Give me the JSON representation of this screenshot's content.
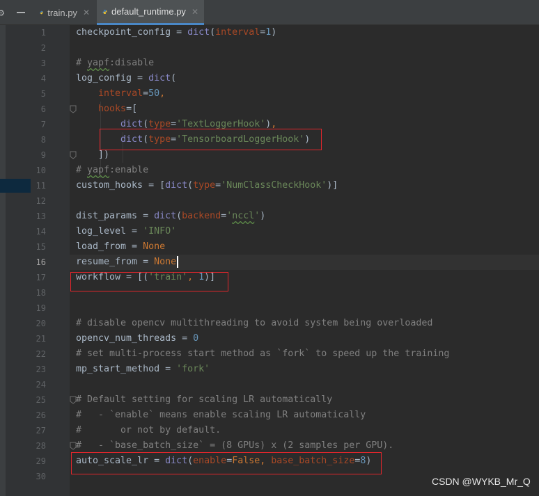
{
  "tabs": [
    {
      "label": "train.py",
      "active": false
    },
    {
      "label": "default_runtime.py",
      "active": true
    }
  ],
  "current_line": 16,
  "lines": [
    {
      "num": "1",
      "tokens": [
        {
          "t": "checkpoint_config = "
        },
        {
          "t": "dict",
          "c": "fn"
        },
        {
          "t": "("
        },
        {
          "t": "interval",
          "c": "kwarg"
        },
        {
          "t": "="
        },
        {
          "t": "1",
          "c": "nm"
        },
        {
          "t": ")"
        }
      ]
    },
    {
      "num": "2",
      "tokens": []
    },
    {
      "num": "3",
      "tokens": [
        {
          "t": "# ",
          "c": "cm"
        },
        {
          "t": "yapf",
          "c": "cm sq"
        },
        {
          "t": ":disable",
          "c": "cm"
        }
      ]
    },
    {
      "num": "4",
      "tokens": [
        {
          "t": "log_config = "
        },
        {
          "t": "dict",
          "c": "fn"
        },
        {
          "t": "("
        }
      ]
    },
    {
      "num": "5",
      "tokens": [
        {
          "t": "    "
        },
        {
          "t": "interval",
          "c": "kwarg"
        },
        {
          "t": "="
        },
        {
          "t": "50",
          "c": "nm"
        },
        {
          "t": ",",
          "c": "kw"
        }
      ]
    },
    {
      "num": "6",
      "tokens": [
        {
          "t": "    "
        },
        {
          "t": "hooks",
          "c": "kwarg"
        },
        {
          "t": "=["
        }
      ]
    },
    {
      "num": "7",
      "tokens": [
        {
          "t": "        "
        },
        {
          "t": "dict",
          "c": "fn"
        },
        {
          "t": "("
        },
        {
          "t": "type",
          "c": "kwarg"
        },
        {
          "t": "="
        },
        {
          "t": "'TextLoggerHook'",
          "c": "st"
        },
        {
          "t": ")"
        },
        {
          "t": ",",
          "c": "kw"
        }
      ]
    },
    {
      "num": "8",
      "tokens": [
        {
          "t": "        "
        },
        {
          "t": "dict",
          "c": "fn"
        },
        {
          "t": "("
        },
        {
          "t": "type",
          "c": "kwarg"
        },
        {
          "t": "="
        },
        {
          "t": "'TensorboardLoggerHook'",
          "c": "st"
        },
        {
          "t": ")"
        }
      ]
    },
    {
      "num": "9",
      "tokens": [
        {
          "t": "    ])"
        }
      ]
    },
    {
      "num": "10",
      "tokens": [
        {
          "t": "# ",
          "c": "cm"
        },
        {
          "t": "yapf",
          "c": "cm sq"
        },
        {
          "t": ":enable",
          "c": "cm"
        }
      ]
    },
    {
      "num": "11",
      "tokens": [
        {
          "t": "custom_hooks = ["
        },
        {
          "t": "dict",
          "c": "fn"
        },
        {
          "t": "("
        },
        {
          "t": "type",
          "c": "kwarg"
        },
        {
          "t": "="
        },
        {
          "t": "'NumClassCheckHook'",
          "c": "st"
        },
        {
          "t": ")]"
        }
      ]
    },
    {
      "num": "12",
      "tokens": []
    },
    {
      "num": "13",
      "tokens": [
        {
          "t": "dist_params = "
        },
        {
          "t": "dict",
          "c": "fn"
        },
        {
          "t": "("
        },
        {
          "t": "backend",
          "c": "kwarg"
        },
        {
          "t": "="
        },
        {
          "t": "'",
          "c": "st"
        },
        {
          "t": "nccl",
          "c": "st sq"
        },
        {
          "t": "'",
          "c": "st"
        },
        {
          "t": ")"
        }
      ]
    },
    {
      "num": "14",
      "tokens": [
        {
          "t": "log_level = "
        },
        {
          "t": "'INFO'",
          "c": "st"
        }
      ]
    },
    {
      "num": "15",
      "tokens": [
        {
          "t": "load_from = "
        },
        {
          "t": "None",
          "c": "kw"
        }
      ]
    },
    {
      "num": "16",
      "tokens": [
        {
          "t": "resume_from = "
        },
        {
          "t": "None",
          "c": "kw"
        }
      ],
      "caret": true
    },
    {
      "num": "17",
      "tokens": [
        {
          "t": "workflow = [("
        },
        {
          "t": "'train'",
          "c": "st"
        },
        {
          "t": ", ",
          "c": "kw"
        },
        {
          "t": "1",
          "c": "nm"
        },
        {
          "t": ")]"
        }
      ]
    },
    {
      "num": "18",
      "tokens": []
    },
    {
      "num": "19",
      "tokens": []
    },
    {
      "num": "20",
      "tokens": [
        {
          "t": "# disable opencv multithreading to avoid system being overloaded",
          "c": "cm"
        }
      ]
    },
    {
      "num": "21",
      "tokens": [
        {
          "t": "opencv_num_threads = "
        },
        {
          "t": "0",
          "c": "nm"
        }
      ]
    },
    {
      "num": "22",
      "tokens": [
        {
          "t": "# set multi-process start method as `fork` to speed up the training",
          "c": "cm"
        }
      ]
    },
    {
      "num": "23",
      "tokens": [
        {
          "t": "mp_start_method = "
        },
        {
          "t": "'fork'",
          "c": "st"
        }
      ]
    },
    {
      "num": "24",
      "tokens": []
    },
    {
      "num": "25",
      "tokens": [
        {
          "t": "# Default setting for scaling LR automatically",
          "c": "cm"
        }
      ]
    },
    {
      "num": "26",
      "tokens": [
        {
          "t": "#   - `enable` means enable scaling LR automatically",
          "c": "cm"
        }
      ]
    },
    {
      "num": "27",
      "tokens": [
        {
          "t": "#       or not by default.",
          "c": "cm"
        }
      ]
    },
    {
      "num": "28",
      "tokens": [
        {
          "t": "#   - `base_batch_size` = (8 GPUs) x (2 samples per GPU).",
          "c": "cm"
        }
      ]
    },
    {
      "num": "29",
      "tokens": [
        {
          "t": "auto_scale_lr = "
        },
        {
          "t": "dict",
          "c": "fn"
        },
        {
          "t": "("
        },
        {
          "t": "enable",
          "c": "kwarg"
        },
        {
          "t": "="
        },
        {
          "t": "False",
          "c": "kw"
        },
        {
          "t": ", ",
          "c": "kw"
        },
        {
          "t": "base_batch_size",
          "c": "kwarg"
        },
        {
          "t": "="
        },
        {
          "t": "8",
          "c": "nm"
        },
        {
          "t": ")"
        }
      ]
    },
    {
      "num": "30",
      "tokens": []
    }
  ],
  "colors": {
    "background": "#2b2b2b",
    "gutter": "#313335",
    "default_text": "#a9b7c6",
    "keyword": "#cc7832",
    "builtin": "#8888c6",
    "string": "#6a8759",
    "number": "#6897bb",
    "comment": "#808080",
    "kwarg": "#aa4926",
    "annotation_box": "#e3262c"
  },
  "icons": {
    "settings": "gear-icon",
    "python_file": "python-file-icon",
    "close_tab": "close-icon",
    "fold_marker": "fold-icon"
  },
  "watermark": "CSDN @WYKB_Mr_Q"
}
